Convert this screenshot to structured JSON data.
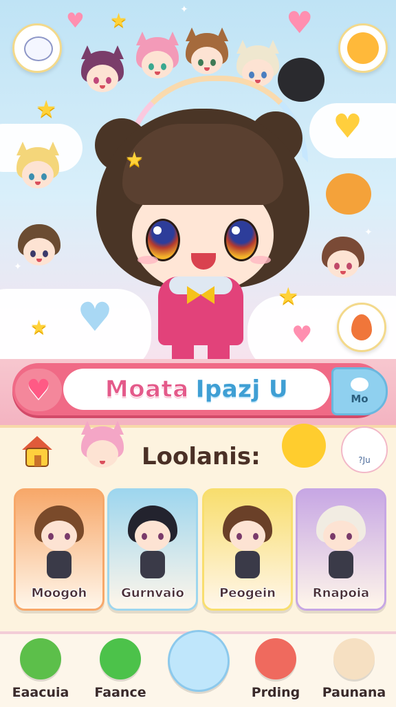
{
  "header": {
    "name_part1": "Moata",
    "name_part2": "Ipazj U",
    "me_label": "Mo"
  },
  "panel": {
    "title": "Loolanis:",
    "badge_text": "?Ju"
  },
  "cards": [
    {
      "label": "Moogoh",
      "color": "#f7a86a",
      "hair": "#7a4a2a"
    },
    {
      "label": "Gurnvaio",
      "color": "#9ed6ee",
      "hair": "#23232e"
    },
    {
      "label": "Peogein",
      "color": "#f8de6e",
      "hair": "#6a4028"
    },
    {
      "label": "Rnapoia",
      "color": "#c7a7e4",
      "hair": "#f1ece2"
    }
  ],
  "nav": [
    {
      "label": "Eaacuia",
      "icon": "dinosaur-icon"
    },
    {
      "label": "Faance",
      "icon": "green-ball-icon"
    },
    {
      "label": "",
      "icon": "bubble-face-icon"
    },
    {
      "label": "Prding",
      "icon": "bear-icon"
    },
    {
      "label": "Paunana",
      "icon": "moon-face-icon"
    }
  ],
  "colors": {
    "accent_pink": "#f06a86",
    "accent_blue": "#3f9fd4",
    "panel_bg": "#fdf3df"
  }
}
